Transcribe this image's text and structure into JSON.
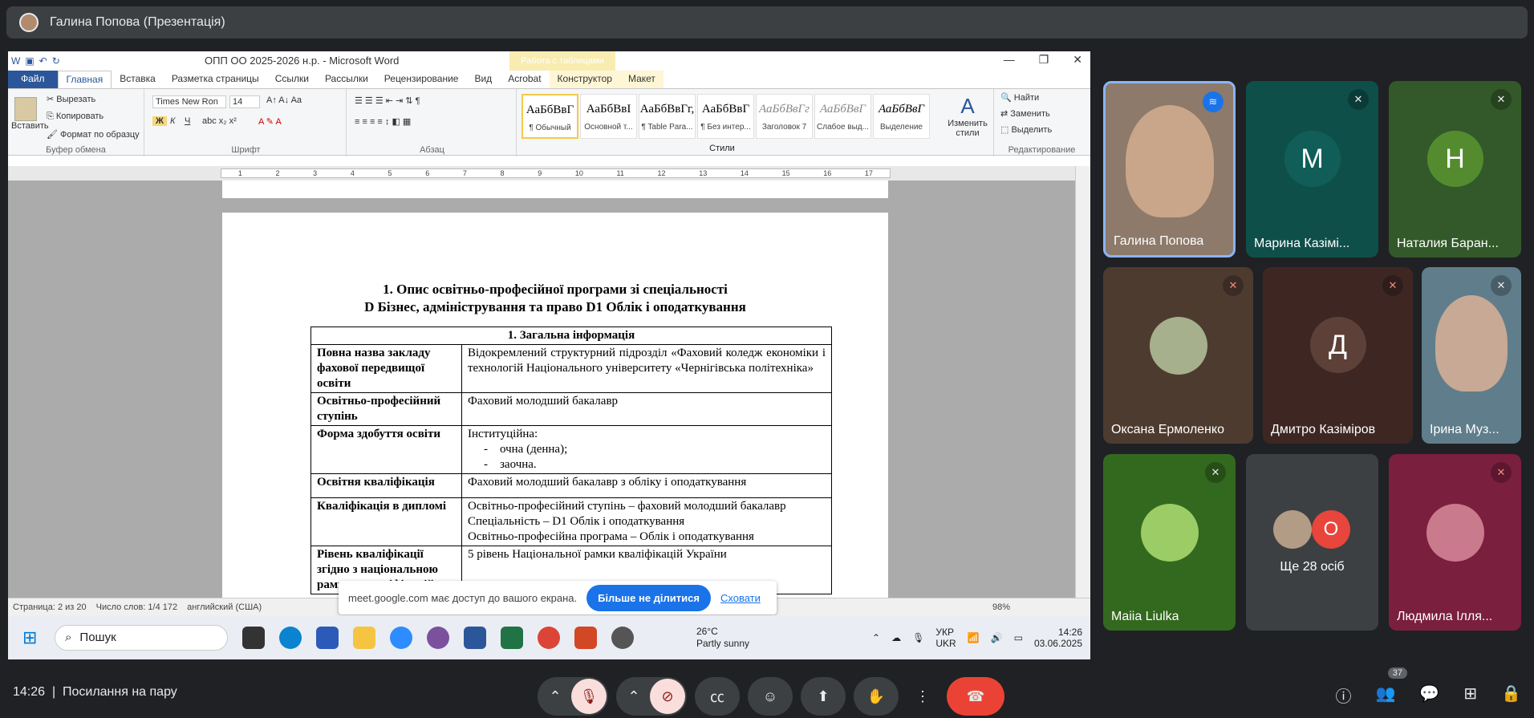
{
  "meeting": {
    "presenter_title": "Галина Попова (Презентація)",
    "time": "14:26",
    "meeting_name": "Посилання на пару",
    "participant_count": "37"
  },
  "word": {
    "doc_title": "ОПП ОО 2025-2026 н.р. - Microsoft Word",
    "context_tab_group": "Работа с таблицами",
    "tabs": [
      "Файл",
      "Главная",
      "Вставка",
      "Разметка страницы",
      "Ссылки",
      "Рассылки",
      "Рецензирование",
      "Вид",
      "Acrobat",
      "Конструктор",
      "Макет"
    ],
    "clipboard": {
      "paste": "Вставить",
      "cut": "Вырезать",
      "copy": "Копировать",
      "format": "Формат по образцу",
      "label": "Буфер обмена"
    },
    "font": {
      "name": "Times New Ron",
      "size": "14",
      "label": "Шрифт"
    },
    "paragraph_label": "Абзац",
    "styles": [
      {
        "preview": "АаБбВвГ",
        "name": "¶ Обычный"
      },
      {
        "preview": "АаБбВвІ",
        "name": "Основной т..."
      },
      {
        "preview": "АаБбВвГг,",
        "name": "¶ Table Para..."
      },
      {
        "preview": "АаБбВвГ",
        "name": "¶ Без интер..."
      },
      {
        "preview": "АаБбВвГг",
        "name": "Заголовок 7"
      },
      {
        "preview": "АаБбВвГ",
        "name": "Слабое выд..."
      },
      {
        "preview": "АаБбВвГ",
        "name": "Выделение"
      }
    ],
    "styles_label": "Стили",
    "change_styles": "Изменить стили",
    "editing": {
      "find": "Найти",
      "replace": "Заменить",
      "select": "Выделить",
      "label": "Редактирование"
    },
    "heading_line1": "1.  Опис освітньо-професійної програми зі спеціальності",
    "heading_line2": "D Бізнес, адміністрування та право D1 Облік і оподаткування",
    "table_header": "1. Загальна інформація",
    "rows": [
      {
        "k": "Повна назва закладу фахової передвищої освіти",
        "v": "Відокремлений структурний підрозділ «Фаховий коледж економіки і технологій Національного університету «Чернігівська політехніка»"
      },
      {
        "k": "Освітньо-професійний ступінь",
        "v": "Фаховий молодший бакалавр"
      },
      {
        "k": "Форма здобуття освіти",
        "v": "Інституційна:",
        "list": [
          "очна (денна);",
          "заочна."
        ]
      },
      {
        "k": "Освітня кваліфікація",
        "v": "Фаховий молодший бакалавр з обліку і оподаткування"
      },
      {
        "k": "Кваліфікація в дипломі",
        "v": "Освітньо-професійний ступінь – фаховий молодший бакалавр",
        "v2": "Спеціальність – D1 Облік і оподаткування",
        "v3": "Освітньо-професійна програма – Облік і оподаткування"
      },
      {
        "k": "Рівень кваліфікації згідно з національною рамкою кваліфікацій",
        "v": "5 рівень Національної рамки кваліфікацій України"
      }
    ],
    "status": {
      "page": "Страница: 2 из 20",
      "words": "Число слов: 1/4 172",
      "lang": "английский (США)",
      "zoom": "98%"
    }
  },
  "share_bar": {
    "text": "meet.google.com має доступ до вашого екрана.",
    "stop": "Більше не ділитися",
    "hide": "Сховати"
  },
  "taskbar": {
    "search": "Пошук",
    "temp": "26°C",
    "weather": "Partly sunny",
    "lang1": "УКР",
    "lang2": "UKR",
    "time": "14:26",
    "date": "03.06.2025"
  },
  "participants": [
    {
      "name": "Галина Попова",
      "color": "#8d7a6a"
    },
    {
      "name": "Марина Казімі...",
      "letter": "М",
      "color": "#115e59"
    },
    {
      "name": "Наталия Баран...",
      "letter": "Н",
      "color": "#558b2f"
    },
    {
      "name": "Оксана Ермоленко",
      "color": "#5d4037"
    },
    {
      "name": "Дмитро Казіміров",
      "letter": "Д",
      "color": "#4e342e"
    },
    {
      "name": "Ірина Муз...",
      "color": "#607d8b"
    },
    {
      "name": "Maiia Liulka",
      "color": "#33691e"
    },
    {
      "name": "Ще 28 осіб",
      "letter": "О",
      "color": "#3c4043"
    },
    {
      "name": "Людмила Ілля...",
      "color": "#880e4f"
    }
  ]
}
